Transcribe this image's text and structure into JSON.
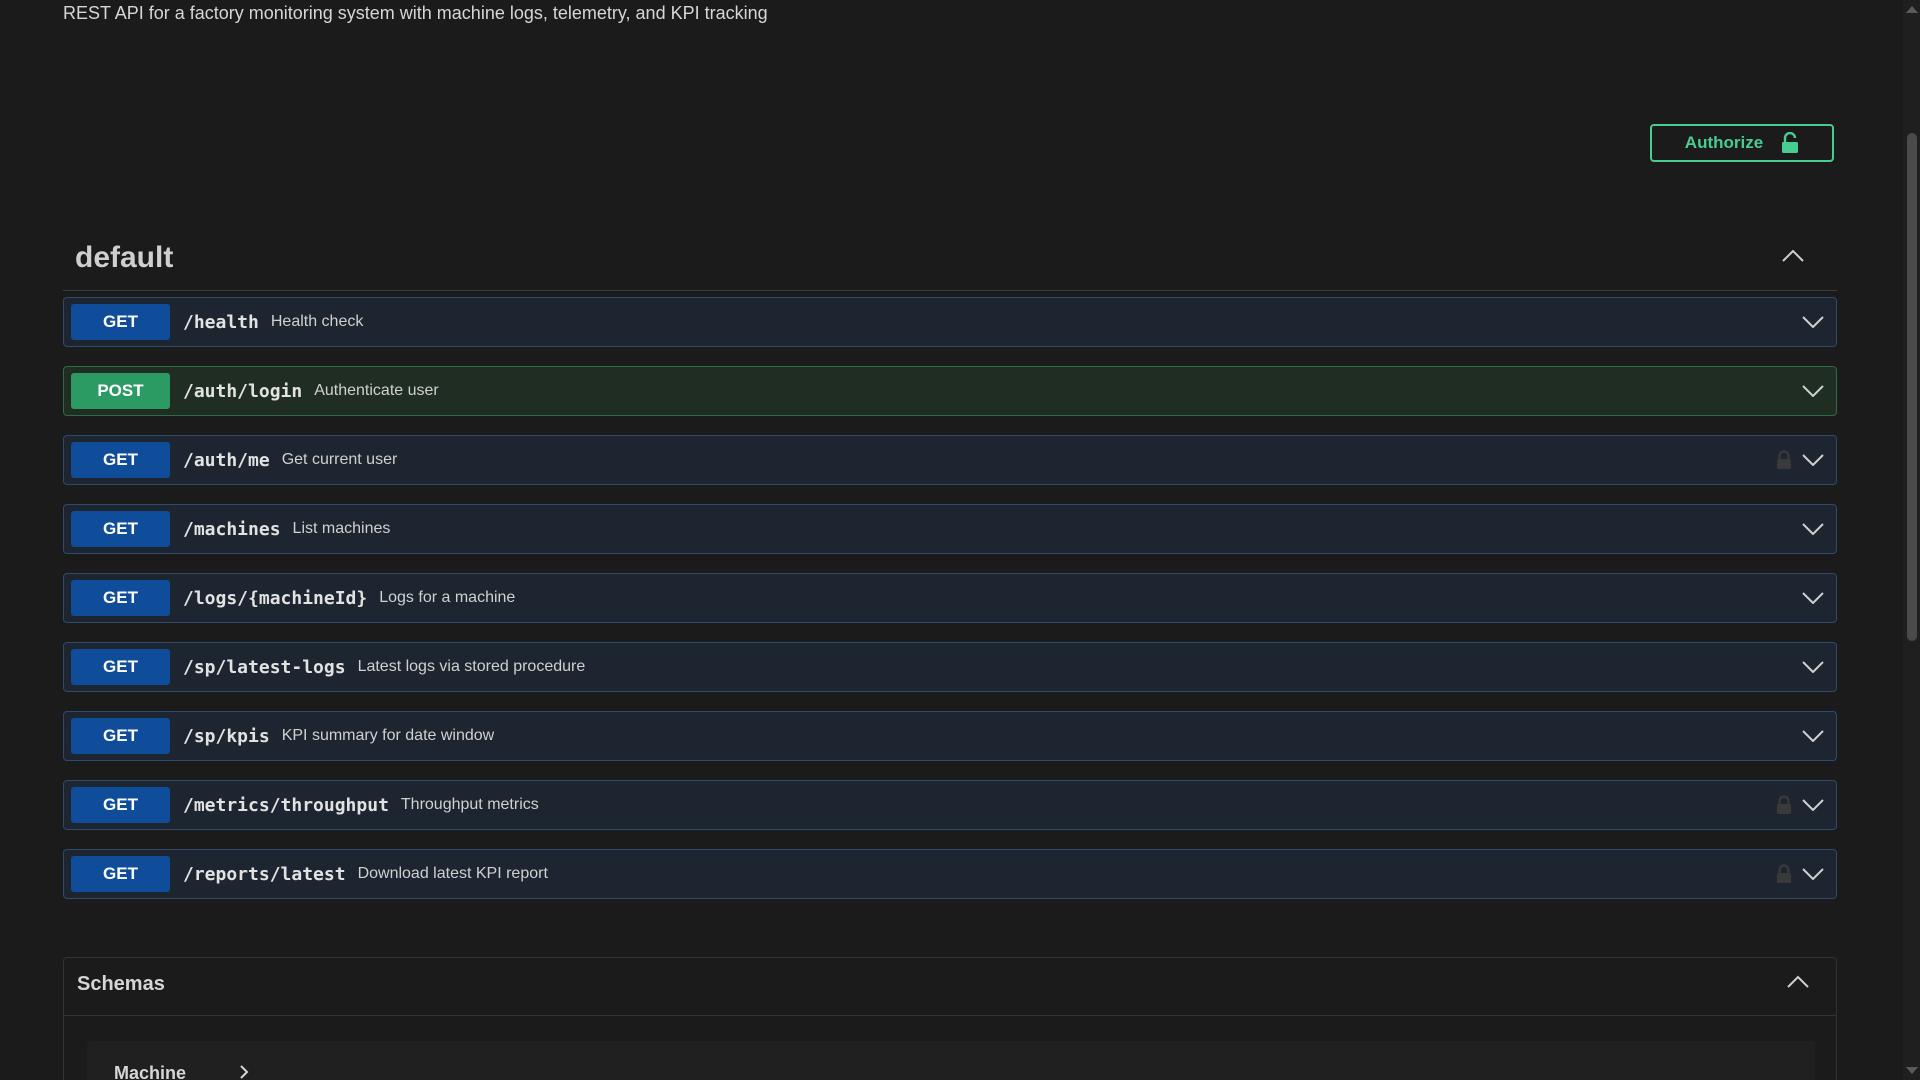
{
  "description": "REST API for a factory monitoring system with machine logs, telemetry, and KPI tracking",
  "authorize": {
    "label": "Authorize",
    "icon": "unlock-icon"
  },
  "section": {
    "title": "default"
  },
  "operations": [
    {
      "method": "GET",
      "path": "/health",
      "summary": "Health check",
      "locked": false
    },
    {
      "method": "POST",
      "path": "/auth/login",
      "summary": "Authenticate user",
      "locked": false
    },
    {
      "method": "GET",
      "path": "/auth/me",
      "summary": "Get current user",
      "locked": true
    },
    {
      "method": "GET",
      "path": "/machines",
      "summary": "List machines",
      "locked": false
    },
    {
      "method": "GET",
      "path": "/logs/{machineId}",
      "summary": "Logs for a machine",
      "locked": false
    },
    {
      "method": "GET",
      "path": "/sp/latest-logs",
      "summary": "Latest logs via stored procedure",
      "locked": false
    },
    {
      "method": "GET",
      "path": "/sp/kpis",
      "summary": "KPI summary for date window",
      "locked": false
    },
    {
      "method": "GET",
      "path": "/metrics/throughput",
      "summary": "Throughput metrics",
      "locked": true
    },
    {
      "method": "GET",
      "path": "/reports/latest",
      "summary": "Download latest KPI report",
      "locked": true
    }
  ],
  "schemas": {
    "title": "Schemas",
    "models": [
      {
        "name": "Machine"
      }
    ]
  },
  "colors": {
    "get": "#0f4c9a",
    "post": "#2c9a63",
    "authorize": "#49cc90",
    "background": "#1b1b1b"
  }
}
